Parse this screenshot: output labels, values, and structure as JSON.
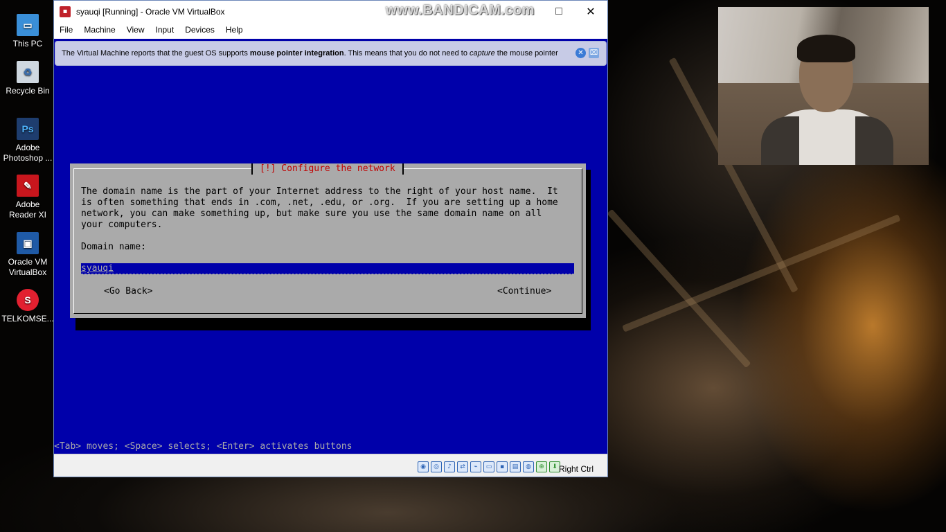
{
  "desktop": {
    "icons": [
      {
        "label": "This PC",
        "icon": "pc-icon"
      },
      {
        "label": "Recycle Bin",
        "icon": "recycle-bin-icon"
      },
      {
        "label": "Adobe Photoshop ...",
        "icon": "photoshop-icon",
        "glyph": "Ps"
      },
      {
        "label": "Adobe Reader XI",
        "icon": "adobe-reader-icon"
      },
      {
        "label": "Oracle VM VirtualBox",
        "icon": "virtualbox-icon"
      },
      {
        "label": "TELKOMSE...",
        "icon": "telkomsel-icon"
      }
    ]
  },
  "watermark": "www.BANDICAM.com",
  "window": {
    "title": "syauqi [Running] - Oracle VM VirtualBox",
    "controls": {
      "maximize": "□",
      "close": "✕"
    },
    "menu": [
      "File",
      "Machine",
      "View",
      "Input",
      "Devices",
      "Help"
    ]
  },
  "notice": {
    "prefix": "The Virtual Machine reports that the guest OS supports ",
    "bold": "mouse pointer integration",
    "middle": ". This means that you do not need to ",
    "italic": "capture",
    "suffix": " the mouse pointer"
  },
  "installer": {
    "dialog_title": "[!] Configure the network",
    "description": "The domain name is the part of your Internet address to the right of your host name.  It\nis often something that ends in .com, .net, .edu, or .org.  If you are setting up a home\nnetwork, you can make something up, but make sure you use the same domain name on all\nyour computers.",
    "field_label": "Domain name:",
    "field_value": "syauqi",
    "back_button": "<Go Back>",
    "continue_button": "<Continue>",
    "hint": "<Tab> moves; <Space> selects; <Enter> activates buttons"
  },
  "statusbar": {
    "host_key": "Right Ctrl",
    "icons": [
      "hard-disk-icon",
      "optical-drive-icon",
      "audio-icon",
      "network-icon",
      "usb-icon",
      "shared-folders-icon",
      "display-icon",
      "video-capture-icon",
      "recording-icon",
      "mouse-integration-icon",
      "keyboard-capture-icon"
    ]
  },
  "colors": {
    "installer_bg": "#0000aa",
    "dialog_bg": "#aaaaaa",
    "dialog_title": "#c00000"
  }
}
